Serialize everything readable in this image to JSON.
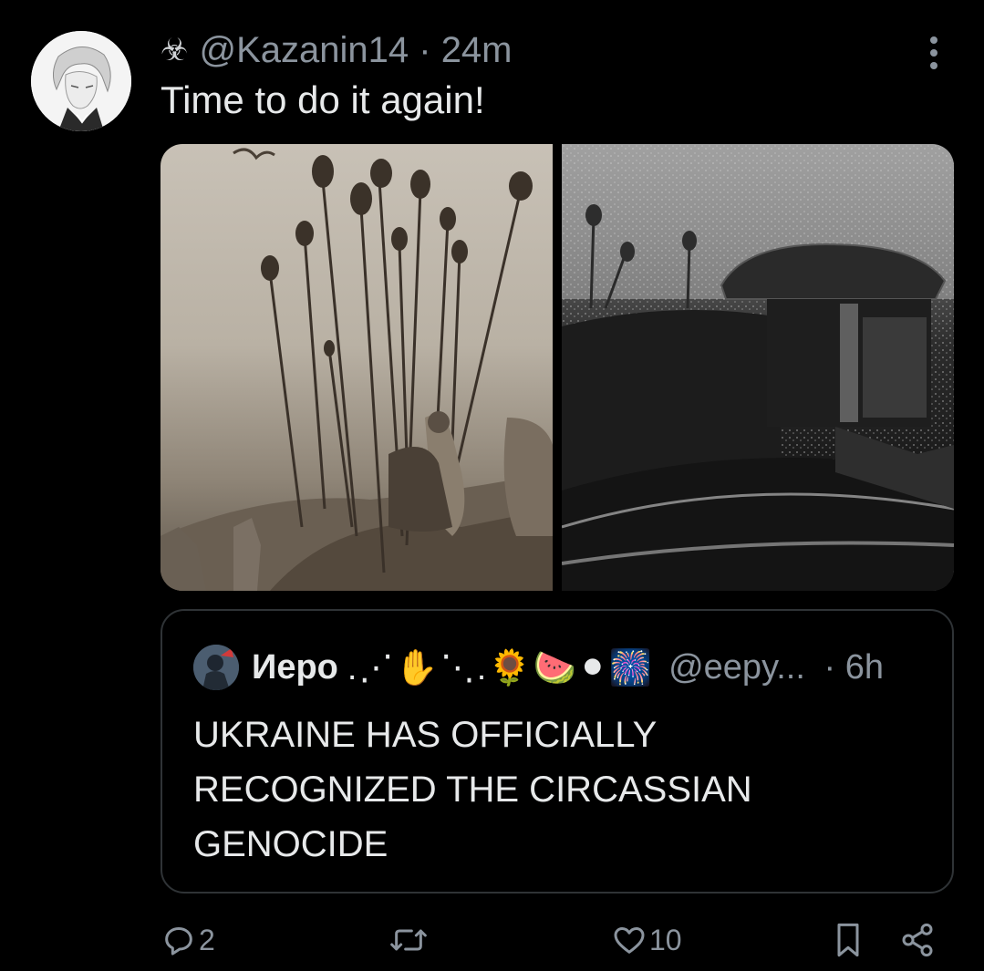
{
  "tweet": {
    "handle_icon": "biohazard-icon",
    "handle_icon_glyph": "☣",
    "handle": "@Kazanin14",
    "separator": " · ",
    "time": "24m",
    "text": "Time to do it again!"
  },
  "media": {
    "images": [
      {
        "name": "media-image-heads-on-pikes"
      },
      {
        "name": "media-image-dark-hut"
      }
    ]
  },
  "quote": {
    "name": "Иеро",
    "emojis": ".⋰✋⋱.🌻🍉⚫🎆",
    "handle": "@eepy...",
    "separator": " · ",
    "time": "6h",
    "text": "UKRAINE HAS OFFICIALLY RECOGNIZED THE CIRCASSIAN GENOCIDE"
  },
  "actions": {
    "reply_count": "2",
    "like_count": "10"
  },
  "colors": {
    "background": "#000000",
    "text": "#e7e9ea",
    "muted": "#8b949e",
    "border": "#2f3336"
  }
}
